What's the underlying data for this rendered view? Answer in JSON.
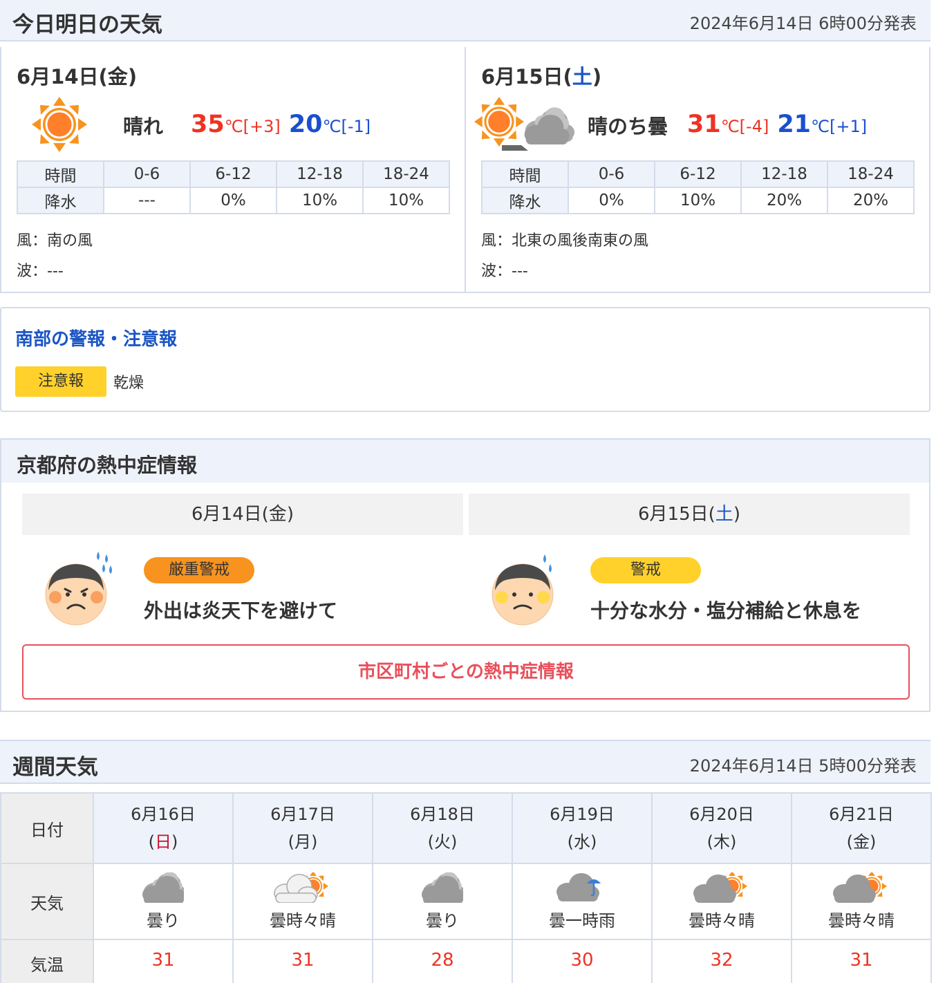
{
  "today_tomorrow": {
    "title": "今日明日の天気",
    "issued": "2024年6月14日 6時00分発表",
    "days": [
      {
        "date": "6月14日(",
        "dow": "金",
        "date_close": ")",
        "weather": "晴れ",
        "high": "35",
        "high_unit": "℃",
        "high_diff": "[+3]",
        "low": "20",
        "low_unit": "℃",
        "low_diff": "[-1]",
        "rain_header": [
          "時間",
          "0-6",
          "6-12",
          "12-18",
          "18-24"
        ],
        "rain_values": [
          "降水",
          "---",
          "0%",
          "10%",
          "10%"
        ],
        "wind": "風：南の風",
        "wave": "波：---"
      },
      {
        "date": "6月15日(",
        "dow": "土",
        "date_close": ")",
        "weather": "晴のち曇",
        "high": "31",
        "high_unit": "℃",
        "high_diff": "[-4]",
        "low": "21",
        "low_unit": "℃",
        "low_diff": "[+1]",
        "rain_header": [
          "時間",
          "0-6",
          "6-12",
          "12-18",
          "18-24"
        ],
        "rain_values": [
          "降水",
          "0%",
          "10%",
          "20%",
          "20%"
        ],
        "wind": "風：北東の風後南東の風",
        "wave": "波：---"
      }
    ]
  },
  "warnings": {
    "title": "南部の警報・注意報",
    "badge": "注意報",
    "text": "乾燥"
  },
  "heatstroke": {
    "title": "京都府の熱中症情報",
    "days": [
      {
        "date": "6月14日(",
        "dow": "金",
        "date_close": ")",
        "level": "厳重警戒",
        "level_color": "#f7931e",
        "message": "外出は炎天下を避けて"
      },
      {
        "date": "6月15日(",
        "dow": "土",
        "date_close": ")",
        "level": "警戒",
        "level_color": "#ffd12a",
        "message": "十分な水分・塩分補給と休息を"
      }
    ],
    "link": "市区町村ごとの熱中症情報"
  },
  "weekly": {
    "title": "週間天気",
    "issued": "2024年6月14日 5時00分発表",
    "row_labels": {
      "date": "日付",
      "weather": "天気",
      "temp": "気温"
    },
    "days": [
      {
        "date": "6月16日",
        "dow_open": "(",
        "dow": "日",
        "dow_close": ")",
        "weather": "曇り",
        "icon": "cloud-icon",
        "high": "31"
      },
      {
        "date": "6月17日",
        "dow_open": "(",
        "dow": "月",
        "dow_close": ")",
        "weather": "曇時々晴",
        "icon": "cloud-sun-icon",
        "high": "31"
      },
      {
        "date": "6月18日",
        "dow_open": "(",
        "dow": "火",
        "dow_close": ")",
        "weather": "曇り",
        "icon": "cloud-icon",
        "high": "28"
      },
      {
        "date": "6月19日",
        "dow_open": "(",
        "dow": "水",
        "dow_close": ")",
        "weather": "曇一時雨",
        "icon": "cloud-umbrella-icon",
        "high": "30"
      },
      {
        "date": "6月20日",
        "dow_open": "(",
        "dow": "木",
        "dow_close": ")",
        "weather": "曇時々晴",
        "icon": "cloud-sun-icon",
        "high": "32"
      },
      {
        "date": "6月21日",
        "dow_open": "(",
        "dow": "金",
        "dow_close": ")",
        "weather": "曇時々晴",
        "icon": "cloud-sun-icon",
        "high": "31"
      }
    ]
  },
  "colors": {
    "accent_blue": "#1a55c4",
    "temp_high": "#ee3322",
    "temp_low": "#1a4fd0",
    "link_red": "#e8505b"
  }
}
